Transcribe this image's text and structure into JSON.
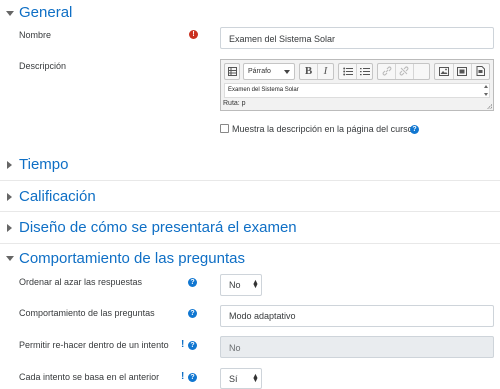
{
  "general": {
    "title": "General",
    "nombre_label": "Nombre",
    "nombre_value": "Examen del Sistema Solar",
    "descripcion_label": "Descripción",
    "editor": {
      "paragraph_select": "Párrafo",
      "bold": "B",
      "italic": "I",
      "content": "Examen del Sistema Solar",
      "path": "Ruta: p"
    },
    "show_description_label": "Muestra la descripción en la página del curso"
  },
  "sections": {
    "tiempo": "Tiempo",
    "calificacion": "Calificación",
    "diseno": "Diseño de cómo se presentará el examen",
    "comportamiento": "Comportamiento de las preguntas"
  },
  "behaviour": {
    "shuffle_label": "Ordenar al azar las respuestas",
    "shuffle_value": "No",
    "behaviour_label": "Comportamiento de las preguntas",
    "behaviour_value": "Modo adaptativo",
    "redo_label": "Permitir re-hacer dentro de un intento",
    "redo_value": "No",
    "each_attempt_label": "Cada intento se basa en el anterior",
    "each_attempt_value": "Sí"
  },
  "icons": {
    "help": "?",
    "error": "!",
    "advanced": "!"
  },
  "colors": {
    "link": "#0f6fc5",
    "help": "#1177d1",
    "error": "#ca3120"
  }
}
